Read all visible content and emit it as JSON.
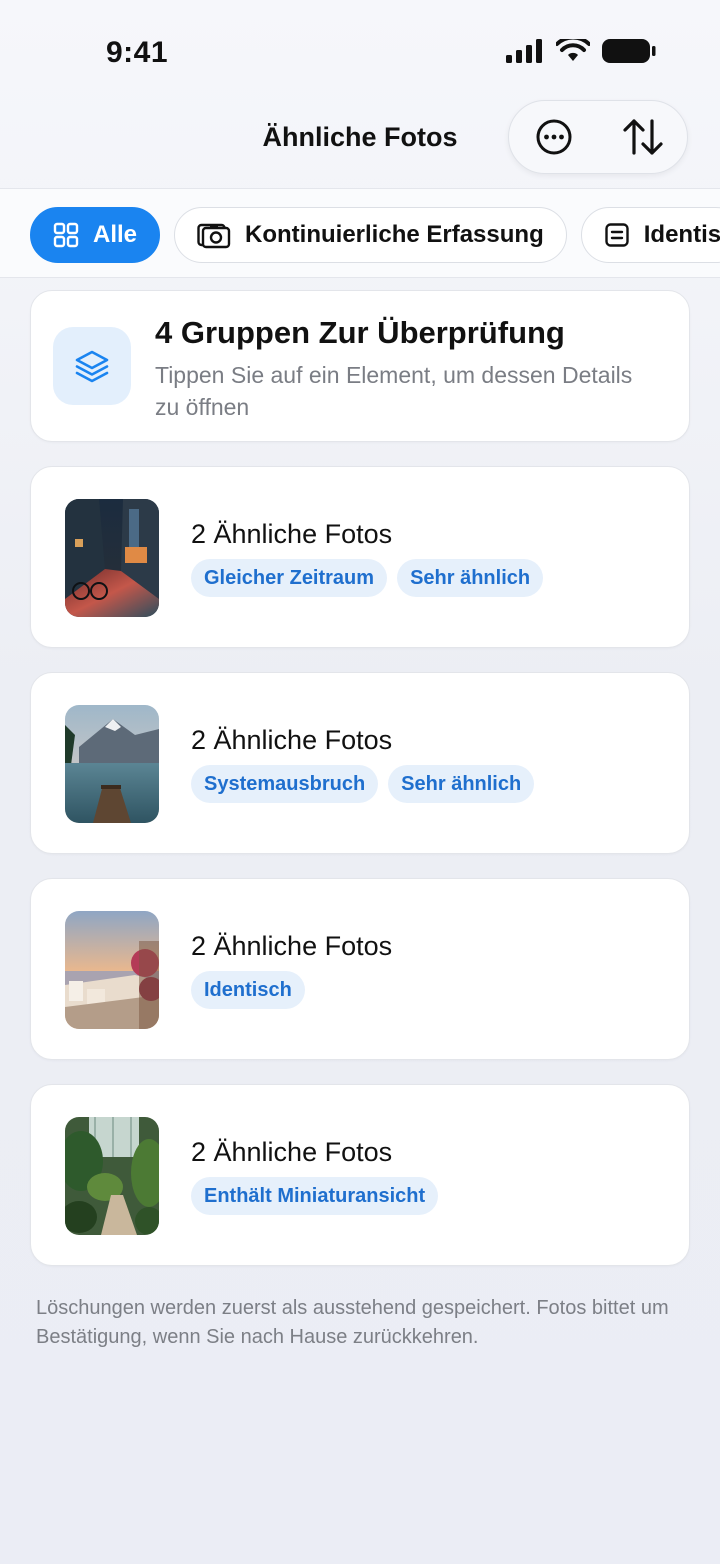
{
  "status": {
    "time": "9:41"
  },
  "header": {
    "title": "Ähnliche Fotos"
  },
  "filters": [
    {
      "label": "Alle",
      "icon": "grid-icon",
      "active": true
    },
    {
      "label": "Kontinuierliche Erfassung",
      "icon": "camera-icon",
      "active": false
    },
    {
      "label": "Identis",
      "icon": "doc-icon",
      "active": false
    }
  ],
  "summary": {
    "title": "4 Gruppen Zur Überprüfung",
    "subtitle": "Tippen Sie auf ein Element, um dessen Details zu öffnen"
  },
  "groups": [
    {
      "title": "2 Ähnliche Fotos",
      "tags": [
        "Gleicher Zeitraum",
        "Sehr ähnlich"
      ],
      "thumb": "rainy-street"
    },
    {
      "title": "2 Ähnliche Fotos",
      "tags": [
        "Systemausbruch",
        "Sehr ähnlich"
      ],
      "thumb": "mountain-lake"
    },
    {
      "title": "2 Ähnliche Fotos",
      "tags": [
        "Identisch"
      ],
      "thumb": "santorini-sunset"
    },
    {
      "title": "2 Ähnliche Fotos",
      "tags": [
        "Enthält Miniaturansicht"
      ],
      "thumb": "greenhouse-path"
    }
  ],
  "footnote": "Löschungen werden zuerst als ausstehend gespeichert. Fotos bittet um Bestätigung, wenn Sie nach Hause zurückkehren.",
  "colors": {
    "accent": "#1a84f0",
    "tag_bg": "#e6f0fb",
    "tag_text": "#1f6fce"
  }
}
